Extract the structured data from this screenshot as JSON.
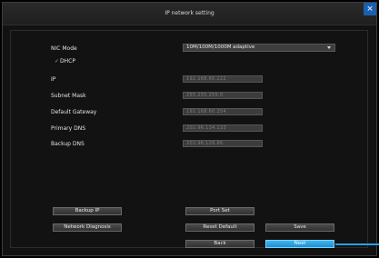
{
  "window": {
    "title": "IP network setting",
    "close_label": "×"
  },
  "form": {
    "nic_mode_label": "NIC Mode",
    "nic_mode_value": "10M/100M/1000M adaptive",
    "dhcp_label": "DHCP",
    "dhcp_checked": true,
    "fields": [
      {
        "label": "IP",
        "value": "192.168.60.222"
      },
      {
        "label": "Subnet Mask",
        "value": "255.255.255.0"
      },
      {
        "label": "Default Gateway",
        "value": "192.168.60.254"
      },
      {
        "label": "Primary DNS",
        "value": "202.96.134.133"
      },
      {
        "label": "Backup DNS",
        "value": "202.96.128.86"
      }
    ]
  },
  "buttons": {
    "backup_ip": "Backup IP",
    "port_set": "Port Set",
    "network_diagnosis": "Network Diagnosis",
    "reset_default": "Reset Default",
    "save": "Save",
    "back": "Back",
    "next": "Next"
  },
  "colors": {
    "accent": "#2aa0e0",
    "background": "#121212",
    "field": "#3c3c3c"
  }
}
